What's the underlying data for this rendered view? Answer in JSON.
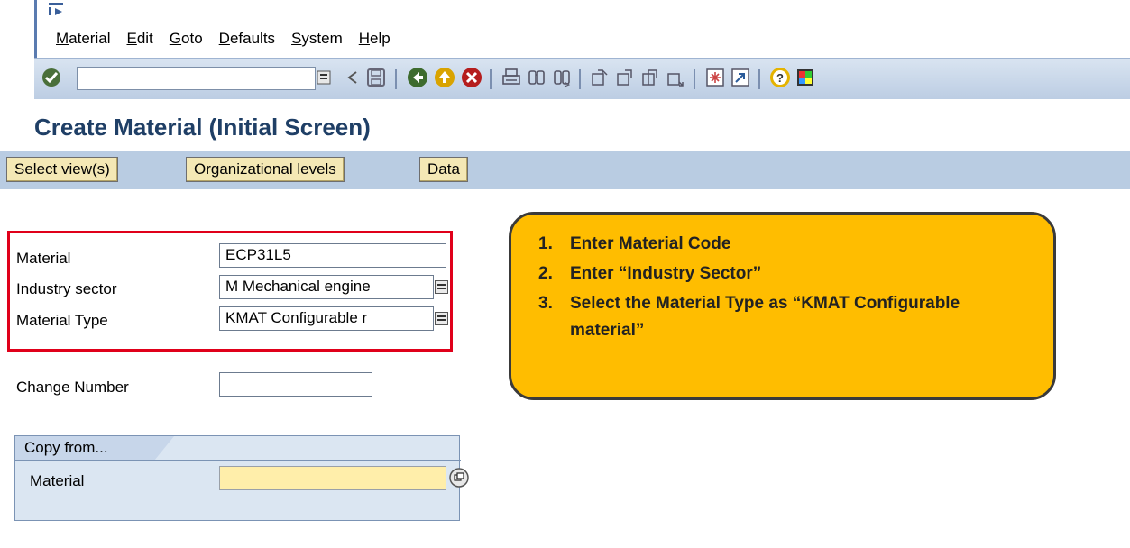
{
  "menu": {
    "items": [
      "Material",
      "Edit",
      "Goto",
      "Defaults",
      "System",
      "Help"
    ]
  },
  "toolbar": {
    "command_field_value": "",
    "icons": [
      "enter-icon",
      "back-arrow-icon",
      "save-icon",
      "back-icon",
      "exit-icon",
      "cancel-icon",
      "print-icon",
      "find-icon",
      "find-next-icon",
      "first-page-icon",
      "prev-page-icon",
      "next-page-icon",
      "last-page-icon",
      "create-session-icon",
      "shortcut-icon",
      "help-icon",
      "customize-layout-icon"
    ]
  },
  "page": {
    "title": "Create Material (Initial Screen)"
  },
  "app_toolbar": {
    "select_views": "Select view(s)",
    "org_levels": "Organizational levels",
    "data": "Data"
  },
  "form": {
    "material_label": "Material",
    "material_value": "ECP31L5",
    "industry_label": "Industry sector",
    "industry_value": "M Mechanical engine",
    "type_label": "Material Type",
    "type_value": "KMAT Configurable r",
    "change_label": "Change Number",
    "change_value": ""
  },
  "copy_from": {
    "tab_label": "Copy from...",
    "material_label": "Material",
    "material_value": ""
  },
  "callout": {
    "steps": [
      {
        "num": "1.",
        "text": "Enter Material Code"
      },
      {
        "num": "2.",
        "text": "Enter “Industry Sector”"
      },
      {
        "num": "3.",
        "text": "Select the Material Type as “KMAT Configurable material”"
      }
    ]
  },
  "colors": {
    "title": "#1f3f66",
    "toolbar_bg": "#c9d8ea",
    "button_bg": "#f4e8b5",
    "callout_bg": "#ffbd00",
    "highlight": "#e0001a"
  }
}
